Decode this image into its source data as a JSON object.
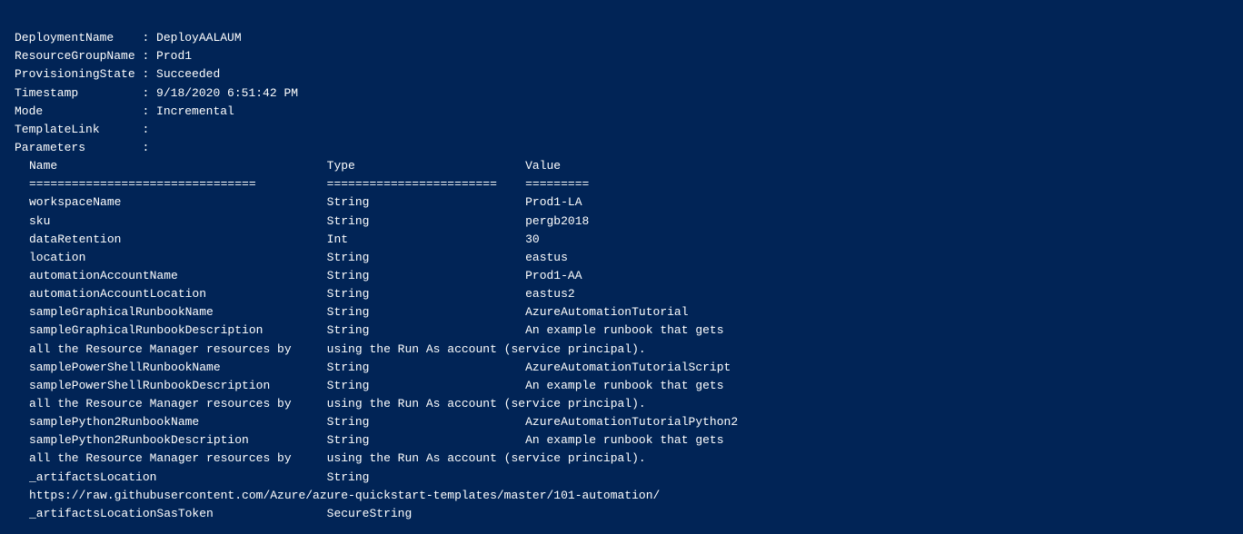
{
  "terminal": {
    "fields": [
      {
        "label": "DeploymentName",
        "value": ": DeployAALAUM"
      },
      {
        "label": "ResourceGroupName",
        "value": ": Prod1"
      },
      {
        "label": "ProvisioningState",
        "value": ": Succeeded"
      },
      {
        "label": "Timestamp",
        "value": ": 9/18/2020 6:51:42 PM"
      },
      {
        "label": "Mode",
        "value": ": Incremental"
      },
      {
        "label": "TemplateLink",
        "value": ":"
      },
      {
        "label": "Parameters",
        "value": ":"
      }
    ],
    "table_header": {
      "name_col": "Name",
      "type_col": "Type",
      "value_col": "Value"
    },
    "table_separator": {
      "name_sep": "================================",
      "type_sep": "========================",
      "value_sep": "========="
    },
    "table_rows": [
      {
        "name": "workspaceName",
        "type": "String",
        "value": "Prod1-LA"
      },
      {
        "name": "sku",
        "type": "String",
        "value": "pergb2018"
      },
      {
        "name": "dataRetention",
        "type": "Int",
        "value": "30"
      },
      {
        "name": "location",
        "type": "String",
        "value": "eastus"
      },
      {
        "name": "automationAccountName",
        "type": "String",
        "value": "Prod1-AA"
      },
      {
        "name": "automationAccountLocation",
        "type": "String",
        "value": "eastus2"
      },
      {
        "name": "sampleGraphicalRunbookName",
        "type": "String",
        "value": "AzureAutomationTutorial"
      },
      {
        "name": "sampleGraphicalRunbookDescription",
        "type": "String",
        "value": "An example runbook that gets"
      },
      {
        "name": "all the Resource Manager resources by",
        "type": "using the Run As account (service principal).",
        "value": ""
      },
      {
        "name": "samplePowerShellRunbookName",
        "type": "String",
        "value": "AzureAutomationTutorialScript"
      },
      {
        "name": "samplePowerShellRunbookDescription",
        "type": "String",
        "value": "An example runbook that gets"
      },
      {
        "name": "all the Resource Manager resources by",
        "type": "using the Run As account (service principal).",
        "value": ""
      },
      {
        "name": "samplePython2RunbookName",
        "type": "String",
        "value": "AzureAutomationTutorialPython2"
      },
      {
        "name": "samplePython2RunbookDescription",
        "type": "String",
        "value": "An example runbook that gets"
      },
      {
        "name": "all the Resource Manager resources by",
        "type": "using the Run As account (service principal).",
        "value": ""
      },
      {
        "name": "_artifactsLocation",
        "type": "String",
        "value": ""
      },
      {
        "name": "https://raw.githubusercontent.com/Azure/azure-quickstart-templates/master/101-automation/",
        "type": "",
        "value": ""
      },
      {
        "name": "_artifactsLocationSasToken",
        "type": "SecureString",
        "value": ""
      }
    ]
  }
}
